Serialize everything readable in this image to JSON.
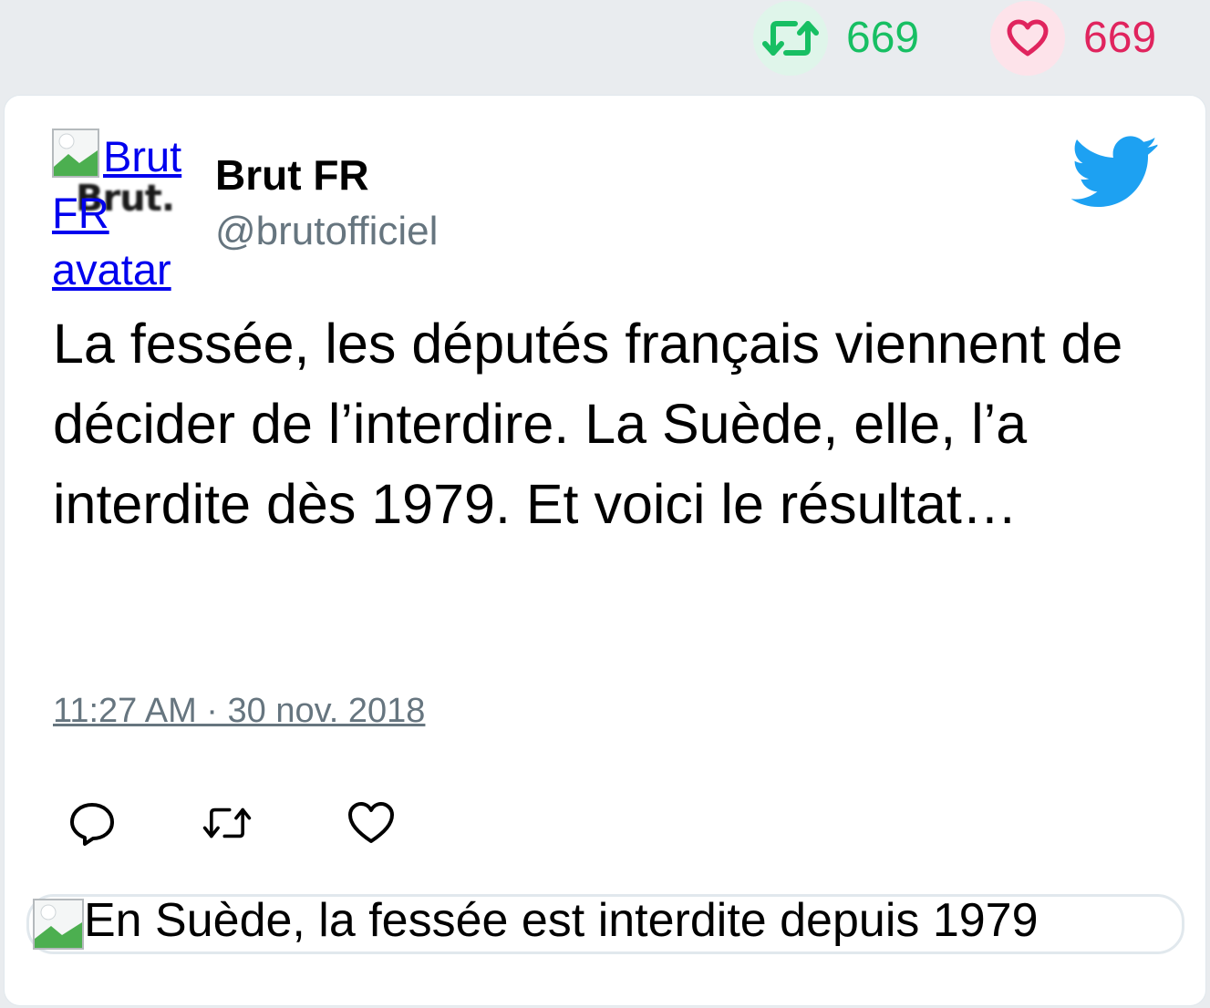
{
  "stats": {
    "retweet_count": "669",
    "like_count": "669",
    "retweet_color": "#17bf63",
    "like_color": "#e0245e"
  },
  "tweet": {
    "avatar_alt": "Brut FR avatar",
    "avatar_logo_text": "Brut.",
    "display_name": "Brut FR",
    "handle": "@brutofficiel",
    "text": "La fessée, les députés français viennent de décider de l’interdire. La Suède, elle, l’a interdite dès 1979. Et voici le résultat…",
    "timestamp": "11:27 AM · 30 nov. 2018",
    "brand_icon": "twitter-bird-icon",
    "brand_color": "#1da1f2"
  },
  "actions": [
    {
      "icon": "reply-icon"
    },
    {
      "icon": "retweet-icon"
    },
    {
      "icon": "like-icon"
    }
  ],
  "preview": {
    "image_alt": "En Suède, la fessée est interdite depuis 1979"
  }
}
